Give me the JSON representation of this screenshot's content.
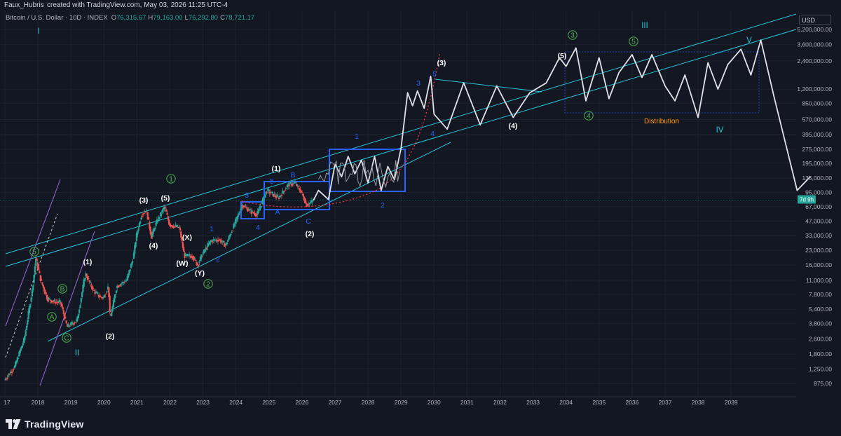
{
  "header": {
    "author": "Faux_Hubris",
    "created_with": "created with TradingView.com, May 03, 2026 11:25 UTC-4"
  },
  "legend": {
    "symbol": "Bitcoin / U.S. Dollar · 10D · INDEX",
    "open_label": "O",
    "open": "76,315.67",
    "high_label": "H",
    "high": "79,163.00",
    "low_label": "L",
    "low": "76,292.80",
    "close_label": "C",
    "close": "78,721.17"
  },
  "currency": "USD",
  "colors": {
    "background": "#131722",
    "channel": "#26c6da",
    "boxes": "#2962ff",
    "projection": "#dfe1e6",
    "candle_up": "#26a69a",
    "candle_down": "#ef5350",
    "wave_green": "#4caf50",
    "wave_blue": "#2962ff",
    "distribution": "#ff9800",
    "price_badge": "#26a69a",
    "red_curve": "#f23645",
    "purple_channel": "#9c6ade"
  },
  "price_badge": "7d 9h",
  "brand": "TradingView",
  "chart_data": {
    "type": "line",
    "scale": "log",
    "x_ticks": [
      "17",
      "2018",
      "2019",
      "2020",
      "2021",
      "2022",
      "2023",
      "2024",
      "2025",
      "2026",
      "2027",
      "2028",
      "2029",
      "2030",
      "2031",
      "2032",
      "2033",
      "2034",
      "2035",
      "2036",
      "2037",
      "2038",
      "2039"
    ],
    "y_ticks": [
      5200000,
      3600000,
      2400000,
      1200000,
      850000,
      570000,
      395000,
      275000,
      195000,
      135000,
      95000,
      67000,
      47000,
      33000,
      23000,
      16000,
      11000,
      7800,
      5400,
      3800,
      2600,
      1800,
      1250,
      875
    ],
    "y_tick_labels": [
      "5,200,000.00",
      "3,600,000.00",
      "2,400,000.00",
      "1,200,000.00",
      "850,000.00",
      "570,000.00",
      "395,000.00",
      "275,000.00",
      "195,000.00",
      "135,000.00",
      "95,000.00",
      "67,000.00",
      "47,000.00",
      "33,000.00",
      "23,000.00",
      "16,000.00",
      "11,000.00",
      "7,800.00",
      "5,400.00",
      "3,800.00",
      "2,600.00",
      "1,800.00",
      "1,250.00",
      "875.00"
    ],
    "historical_price": [
      [
        2017.0,
        950
      ],
      [
        2017.3,
        1300
      ],
      [
        2017.6,
        2600
      ],
      [
        2017.85,
        9000
      ],
      [
        2017.95,
        19000
      ],
      [
        2018.1,
        11000
      ],
      [
        2018.3,
        7000
      ],
      [
        2018.5,
        6500
      ],
      [
        2018.7,
        6400
      ],
      [
        2018.9,
        3500
      ],
      [
        2019.0,
        3700
      ],
      [
        2019.2,
        4100
      ],
      [
        2019.45,
        13000
      ],
      [
        2019.7,
        8500
      ],
      [
        2019.9,
        7300
      ],
      [
        2020.0,
        7200
      ],
      [
        2020.15,
        9500
      ],
      [
        2020.2,
        4200
      ],
      [
        2020.4,
        9500
      ],
      [
        2020.7,
        11000
      ],
      [
        2020.9,
        19000
      ],
      [
        2021.0,
        33000
      ],
      [
        2021.15,
        55000
      ],
      [
        2021.3,
        62000
      ],
      [
        2021.45,
        32000
      ],
      [
        2021.6,
        45000
      ],
      [
        2021.85,
        67000
      ],
      [
        2022.0,
        43000
      ],
      [
        2022.3,
        40000
      ],
      [
        2022.45,
        20000
      ],
      [
        2022.7,
        20000
      ],
      [
        2022.85,
        16000
      ],
      [
        2023.0,
        21000
      ],
      [
        2023.25,
        29000
      ],
      [
        2023.5,
        30000
      ],
      [
        2023.7,
        26000
      ],
      [
        2023.9,
        38000
      ],
      [
        2024.2,
        70000
      ],
      [
        2024.45,
        60000
      ],
      [
        2024.65,
        55000
      ],
      [
        2024.95,
        100000
      ],
      [
        2025.3,
        83000
      ],
      [
        2025.6,
        115000
      ],
      [
        2025.8,
        120000
      ],
      [
        2026.0,
        95000
      ],
      [
        2026.15,
        70000
      ],
      [
        2026.3,
        75000
      ],
      [
        2026.35,
        78721
      ]
    ],
    "projection_path": [
      [
        2026.35,
        78721
      ],
      [
        2026.5,
        100000
      ],
      [
        2026.8,
        80000
      ],
      [
        2027.0,
        190000
      ],
      [
        2027.2,
        140000
      ],
      [
        2027.4,
        230000
      ],
      [
        2027.6,
        150000
      ],
      [
        2027.8,
        210000
      ],
      [
        2028.0,
        120000
      ],
      [
        2028.2,
        230000
      ],
      [
        2028.4,
        100000
      ],
      [
        2028.6,
        180000
      ],
      [
        2028.8,
        130000
      ],
      [
        2029.0,
        280000
      ],
      [
        2029.2,
        1100000
      ],
      [
        2029.35,
        800000
      ],
      [
        2029.5,
        1150000
      ],
      [
        2029.7,
        750000
      ],
      [
        2029.9,
        1650000
      ],
      [
        2030.0,
        650000
      ],
      [
        2030.4,
        450000
      ],
      [
        2030.9,
        1400000
      ],
      [
        2031.4,
        500000
      ],
      [
        2031.9,
        1300000
      ],
      [
        2032.4,
        600000
      ],
      [
        2032.9,
        1100000
      ],
      [
        2033.4,
        1400000
      ],
      [
        2033.8,
        2600000
      ],
      [
        2034.0,
        2100000
      ],
      [
        2034.3,
        3300000
      ],
      [
        2034.6,
        900000
      ],
      [
        2035.0,
        2600000
      ],
      [
        2035.3,
        950000
      ],
      [
        2035.6,
        1800000
      ],
      [
        2036.0,
        2800000
      ],
      [
        2036.3,
        1600000
      ],
      [
        2036.6,
        2800000
      ],
      [
        2037.0,
        1300000
      ],
      [
        2037.3,
        900000
      ],
      [
        2037.6,
        1700000
      ],
      [
        2038.0,
        600000
      ],
      [
        2038.3,
        2300000
      ],
      [
        2038.6,
        1200000
      ],
      [
        2038.9,
        2200000
      ],
      [
        2039.3,
        3200000
      ],
      [
        2039.6,
        1700000
      ],
      [
        2039.9,
        4000000
      ],
      [
        2040.3,
        1000000
      ],
      [
        2041.0,
        100000
      ],
      [
        2041.4,
        140000
      ]
    ],
    "wave_labels": [
      {
        "text": "I",
        "color": "#26c6da"
      },
      {
        "text": "II",
        "color": "#26c6da"
      },
      {
        "text": "III",
        "color": "#26c6da"
      },
      {
        "text": "IV",
        "color": "#26c6da"
      },
      {
        "text": "V",
        "color": "#26c6da"
      },
      {
        "text": "1",
        "color": "#4caf50",
        "circled": true
      },
      {
        "text": "2",
        "color": "#4caf50",
        "circled": true
      },
      {
        "text": "3",
        "color": "#4caf50",
        "circled": true
      },
      {
        "text": "4",
        "color": "#4caf50",
        "circled": true
      },
      {
        "text": "5",
        "color": "#4caf50",
        "circled": true
      },
      {
        "text": "5",
        "color": "#4caf50",
        "circled": true
      },
      {
        "text": "A",
        "color": "#4caf50",
        "circled": true
      },
      {
        "text": "B",
        "color": "#4caf50",
        "circled": true
      },
      {
        "text": "C",
        "color": "#4caf50",
        "circled": true
      },
      {
        "text": "(1)",
        "color": "#ffffff"
      },
      {
        "text": "(2)",
        "color": "#ffffff"
      },
      {
        "text": "(3)",
        "color": "#ffffff"
      },
      {
        "text": "(4)",
        "color": "#ffffff"
      },
      {
        "text": "(5)",
        "color": "#ffffff"
      },
      {
        "text": "(X)",
        "color": "#ffffff"
      },
      {
        "text": "(W)",
        "color": "#ffffff"
      },
      {
        "text": "(Y)",
        "color": "#ffffff"
      },
      {
        "text": "(1)",
        "color": "#ffffff"
      },
      {
        "text": "(2)",
        "color": "#ffffff"
      },
      {
        "text": "(3)",
        "color": "#ffffff"
      },
      {
        "text": "(4)",
        "color": "#ffffff"
      },
      {
        "text": "(5)",
        "color": "#ffffff"
      },
      {
        "text": "1",
        "color": "#2962ff"
      },
      {
        "text": "2",
        "color": "#2962ff"
      },
      {
        "text": "3",
        "color": "#2962ff"
      },
      {
        "text": "4",
        "color": "#2962ff"
      },
      {
        "text": "5",
        "color": "#2962ff"
      },
      {
        "text": "A",
        "color": "#2962ff"
      },
      {
        "text": "B",
        "color": "#2962ff"
      },
      {
        "text": "C",
        "color": "#2962ff"
      },
      {
        "text": "1",
        "color": "#2962ff"
      },
      {
        "text": "2",
        "color": "#2962ff"
      },
      {
        "text": "3",
        "color": "#2962ff"
      },
      {
        "text": "4",
        "color": "#2962ff"
      },
      {
        "text": "5",
        "color": "#2962ff"
      },
      {
        "text": "Distribution",
        "color": "#ff9800"
      }
    ]
  }
}
